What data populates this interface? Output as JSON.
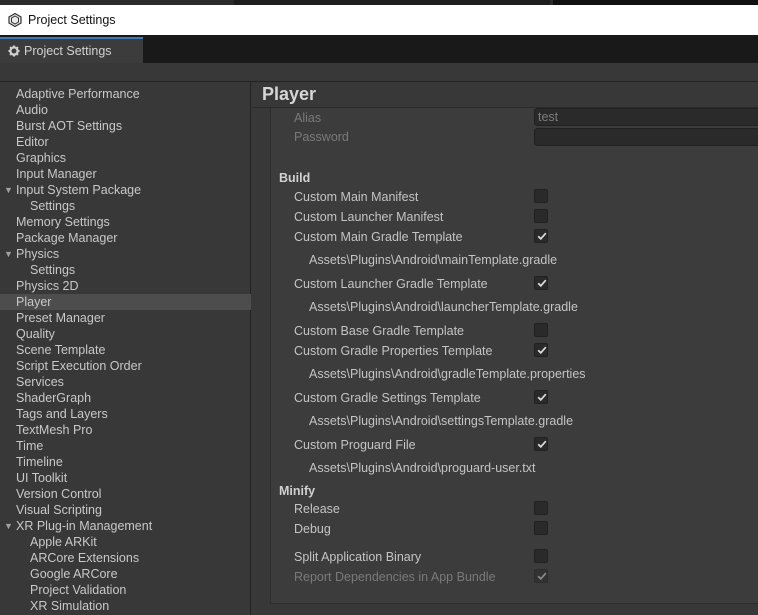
{
  "window": {
    "title": "Project Settings"
  },
  "tab": {
    "label": "Project Settings"
  },
  "page": {
    "title": "Player"
  },
  "sidebar": {
    "items": [
      {
        "label": "Adaptive Performance"
      },
      {
        "label": "Audio"
      },
      {
        "label": "Burst AOT Settings"
      },
      {
        "label": "Editor"
      },
      {
        "label": "Graphics"
      },
      {
        "label": "Input Manager"
      },
      {
        "label": "Input System Package"
      },
      {
        "label": "Settings"
      },
      {
        "label": "Memory Settings"
      },
      {
        "label": "Package Manager"
      },
      {
        "label": "Physics"
      },
      {
        "label": "Settings"
      },
      {
        "label": "Physics 2D"
      },
      {
        "label": "Player"
      },
      {
        "label": "Preset Manager"
      },
      {
        "label": "Quality"
      },
      {
        "label": "Scene Template"
      },
      {
        "label": "Script Execution Order"
      },
      {
        "label": "Services"
      },
      {
        "label": "ShaderGraph"
      },
      {
        "label": "Tags and Layers"
      },
      {
        "label": "TextMesh Pro"
      },
      {
        "label": "Time"
      },
      {
        "label": "Timeline"
      },
      {
        "label": "UI Toolkit"
      },
      {
        "label": "Version Control"
      },
      {
        "label": "Visual Scripting"
      },
      {
        "label": "XR Plug-in Management"
      },
      {
        "label": "Apple ARKit"
      },
      {
        "label": "ARCore Extensions"
      },
      {
        "label": "Google ARCore"
      },
      {
        "label": "Project Validation"
      },
      {
        "label": "XR Simulation"
      }
    ],
    "selected": "Player"
  },
  "keystore": {
    "alias_label": "Alias",
    "alias_value": "test",
    "password_label": "Password",
    "password_value": ""
  },
  "build": {
    "header": "Build",
    "custom_main_manifest": {
      "label": "Custom Main Manifest",
      "checked": false
    },
    "custom_launcher_manifest": {
      "label": "Custom Launcher Manifest",
      "checked": false
    },
    "custom_main_gradle": {
      "label": "Custom Main Gradle Template",
      "checked": true,
      "path": "Assets\\Plugins\\Android\\mainTemplate.gradle"
    },
    "custom_launcher_gradle": {
      "label": "Custom Launcher Gradle Template",
      "checked": true,
      "path": "Assets\\Plugins\\Android\\launcherTemplate.gradle"
    },
    "custom_base_gradle": {
      "label": "Custom Base Gradle Template",
      "checked": false
    },
    "custom_gradle_properties": {
      "label": "Custom Gradle Properties Template",
      "checked": true,
      "path": "Assets\\Plugins\\Android\\gradleTemplate.properties"
    },
    "custom_gradle_settings": {
      "label": "Custom Gradle Settings Template",
      "checked": true,
      "path": "Assets\\Plugins\\Android\\settingsTemplate.gradle"
    },
    "custom_proguard": {
      "label": "Custom Proguard File",
      "checked": true,
      "path": "Assets\\Plugins\\Android\\proguard-user.txt"
    }
  },
  "minify": {
    "header": "Minify",
    "release": {
      "label": "Release",
      "checked": false
    },
    "debug": {
      "label": "Debug",
      "checked": false
    }
  },
  "split_binary": {
    "label": "Split Application Binary",
    "checked": false
  },
  "report_deps": {
    "label": "Report Dependencies in App Bundle",
    "checked": true,
    "disabled": true
  },
  "colors": {
    "background": "#383838",
    "sidebar_selected": "#4d4d4d",
    "field_bg": "#2a2a2a",
    "tab_accent": "#3a79bb",
    "titlebar_bg": "#ffffff"
  }
}
